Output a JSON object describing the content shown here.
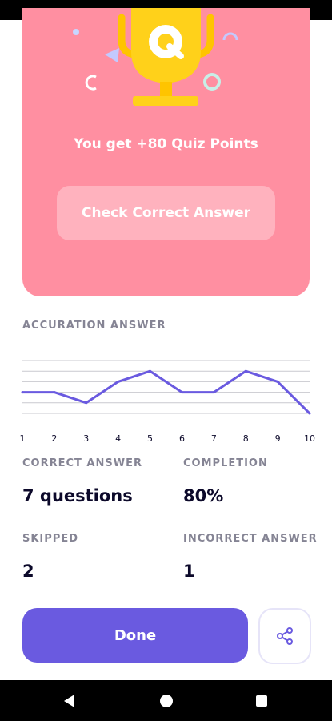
{
  "result": {
    "points_text": "You get +80 Quiz Points",
    "check_answer_label": "Check Correct Answer"
  },
  "accuracy": {
    "label": "ACCURATION ANSWER"
  },
  "chart_data": {
    "type": "line",
    "x": [
      1,
      2,
      3,
      4,
      5,
      6,
      7,
      8,
      9,
      10
    ],
    "values": [
      2,
      2,
      1,
      3,
      4,
      2,
      2,
      4,
      3,
      0
    ],
    "ylim": [
      0,
      5
    ],
    "grid": true,
    "title": "",
    "xlabel": "",
    "ylabel": "",
    "line_color": "#6a5ae0"
  },
  "stats": {
    "correct_label": "CORRECT ANSWER",
    "correct_value": "7 questions",
    "completion_label": "COMPLETION",
    "completion_value": "80%",
    "skipped_label": "SKIPPED",
    "skipped_value": "2",
    "incorrect_label": "INCORRECT ANSWER",
    "incorrect_value": "1"
  },
  "actions": {
    "done_label": "Done",
    "share_icon": "share-icon"
  },
  "colors": {
    "card": "#ff8fa1",
    "primary": "#6a5ae0",
    "trophy": "#ffd11a"
  }
}
